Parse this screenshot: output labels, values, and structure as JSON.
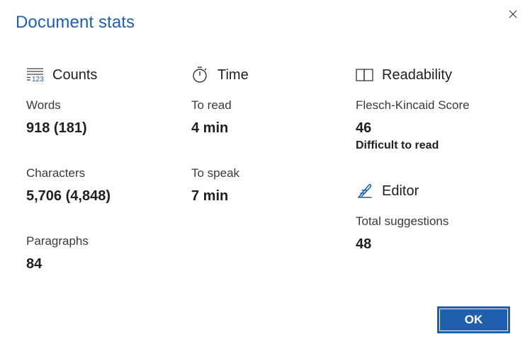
{
  "dialog": {
    "title": "Document stats",
    "ok_label": "OK"
  },
  "counts": {
    "heading": "Counts",
    "icon": "counts-123-icon",
    "words_label": "Words",
    "words_value": "918 (181)",
    "characters_label": "Characters",
    "characters_value": "5,706 (4,848)",
    "paragraphs_label": "Paragraphs",
    "paragraphs_value": "84"
  },
  "time": {
    "heading": "Time",
    "icon": "stopwatch-icon",
    "to_read_label": "To read",
    "to_read_value": "4 min",
    "to_speak_label": "To speak",
    "to_speak_value": "7 min"
  },
  "readability": {
    "heading": "Readability",
    "icon": "open-book-icon",
    "score_label": "Flesch-Kincaid Score",
    "score_value": "46",
    "score_desc": "Difficult to read"
  },
  "editor": {
    "heading": "Editor",
    "icon": "pen-icon",
    "suggestions_label": "Total suggestions",
    "suggestions_value": "48"
  },
  "colors": {
    "accent": "#1f5fae",
    "text": "#1f1f1f"
  }
}
